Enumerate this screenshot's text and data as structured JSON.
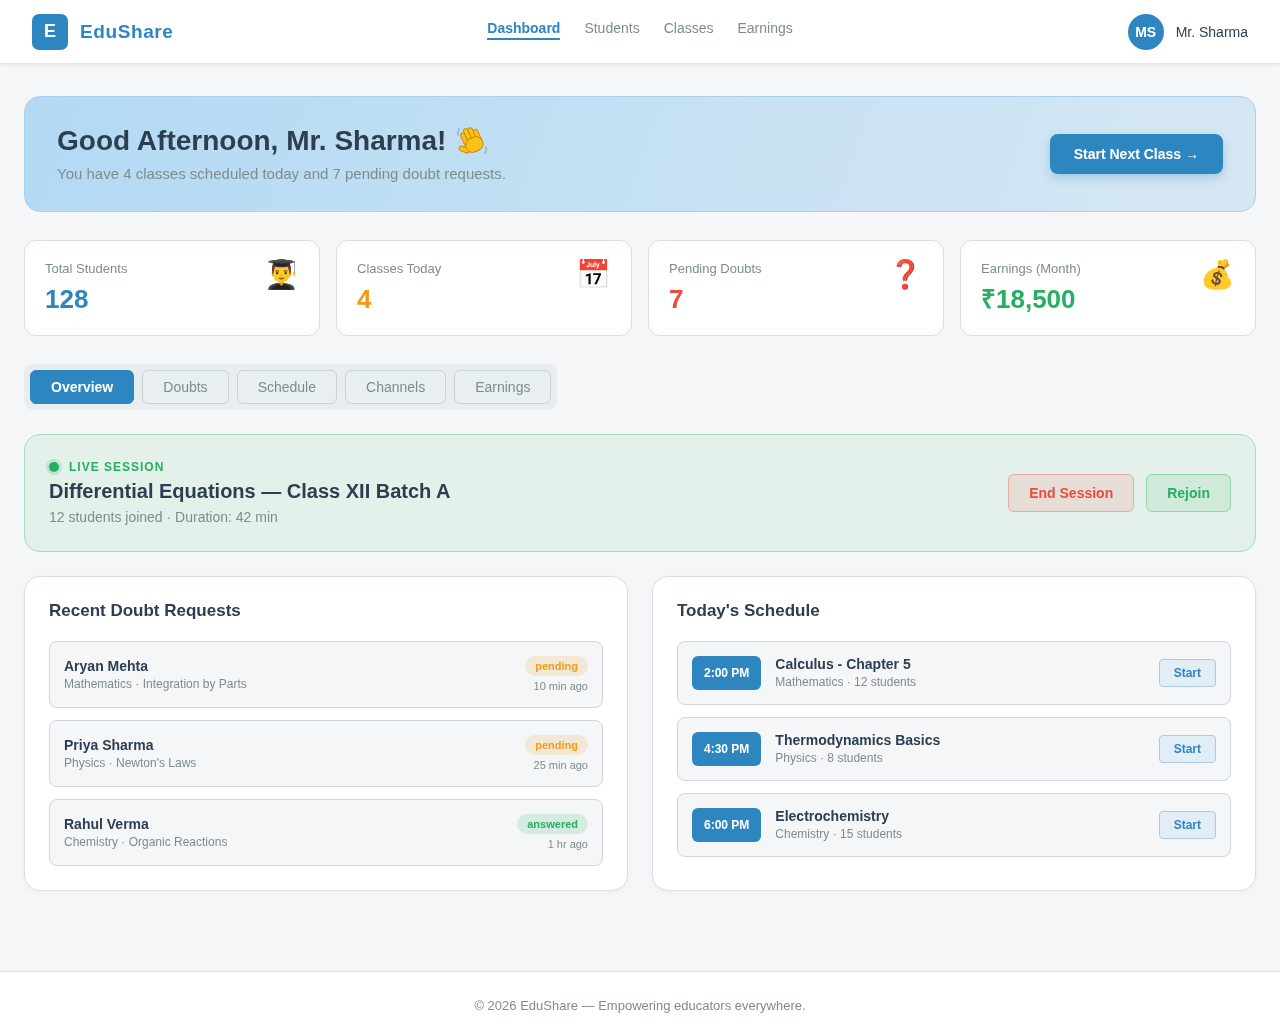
{
  "header": {
    "logo_letter": "E",
    "brand": "EduShare",
    "nav": [
      {
        "label": "Dashboard",
        "selected": true
      },
      {
        "label": "Students",
        "selected": false
      },
      {
        "label": "Classes",
        "selected": false
      },
      {
        "label": "Earnings",
        "selected": false
      }
    ],
    "avatar": "MS",
    "user_name": "Mr. Sharma"
  },
  "hero": {
    "title": "Good Afternoon, Mr. Sharma!",
    "subtitle": "You have 4 classes scheduled today and 7 pending doubt requests.",
    "button": "Start Next Class →"
  },
  "stats": [
    {
      "label": "Total Students",
      "value": "128",
      "icon": "👨‍🎓",
      "color": "#2e86c1"
    },
    {
      "label": "Classes Today",
      "value": "4",
      "icon": "📅",
      "color": "#f39c12"
    },
    {
      "label": "Pending Doubts",
      "value": "7",
      "icon": "❓",
      "color": "#e74c3c"
    },
    {
      "label": "Earnings (Month)",
      "value": "₹18,500",
      "icon": "💰",
      "color": "#27ae60"
    }
  ],
  "tabs": [
    {
      "label": "Overview",
      "selected": true
    },
    {
      "label": "Doubts",
      "selected": false
    },
    {
      "label": "Schedule",
      "selected": false
    },
    {
      "label": "Channels",
      "selected": false
    },
    {
      "label": "Earnings",
      "selected": false
    }
  ],
  "live_session": {
    "badge": "LIVE SESSION",
    "title": "Differential Equations — Class XII Batch A",
    "meta": "12 students joined · Duration: 42 min",
    "buttons": [
      {
        "label": "End Session",
        "kind": "danger"
      },
      {
        "label": "Rejoin",
        "kind": "success"
      }
    ]
  },
  "doubts": {
    "title": "Recent Doubt Requests",
    "items": [
      {
        "name": "Aryan Mehta",
        "meta": "Mathematics · Integration by Parts",
        "status": "pending",
        "color": "#f39c12",
        "time": "10 min ago"
      },
      {
        "name": "Priya Sharma",
        "meta": "Physics · Newton's Laws",
        "status": "pending",
        "color": "#f39c12",
        "time": "25 min ago"
      },
      {
        "name": "Rahul Verma",
        "meta": "Chemistry · Organic Reactions",
        "status": "answered",
        "color": "#27ae60",
        "time": "1 hr ago"
      }
    ]
  },
  "schedule": {
    "title": "Today's Schedule",
    "items": [
      {
        "time": "2:00 PM",
        "title": "Calculus - Chapter 5",
        "meta": "Mathematics · 12 students",
        "button": "Start"
      },
      {
        "time": "4:30 PM",
        "title": "Thermodynamics Basics",
        "meta": "Physics · 8 students",
        "button": "Start"
      },
      {
        "time": "6:00 PM",
        "title": "Electrochemistry",
        "meta": "Chemistry · 15 students",
        "button": "Start"
      }
    ]
  },
  "footer": "© 2026 EduShare — Empowering educators everywhere."
}
